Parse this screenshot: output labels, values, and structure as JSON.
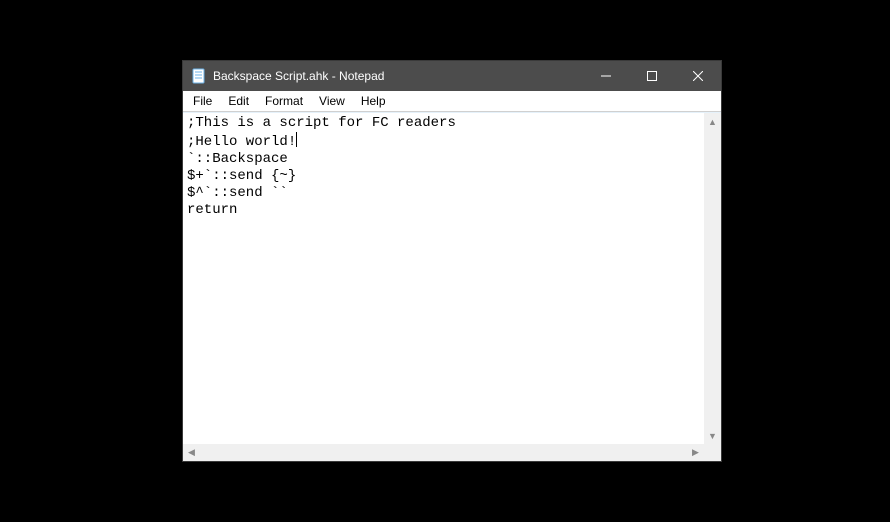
{
  "window": {
    "title": "Backspace Script.ahk - Notepad"
  },
  "menu": {
    "file": "File",
    "edit": "Edit",
    "format": "Format",
    "view": "View",
    "help": "Help"
  },
  "editor": {
    "line1": ";This is a script for FC readers",
    "line2": ";Hello world!",
    "line3": "`::Backspace",
    "line4": "$+`::send {~}",
    "line5": "$^`::send ``",
    "line6": "return"
  }
}
